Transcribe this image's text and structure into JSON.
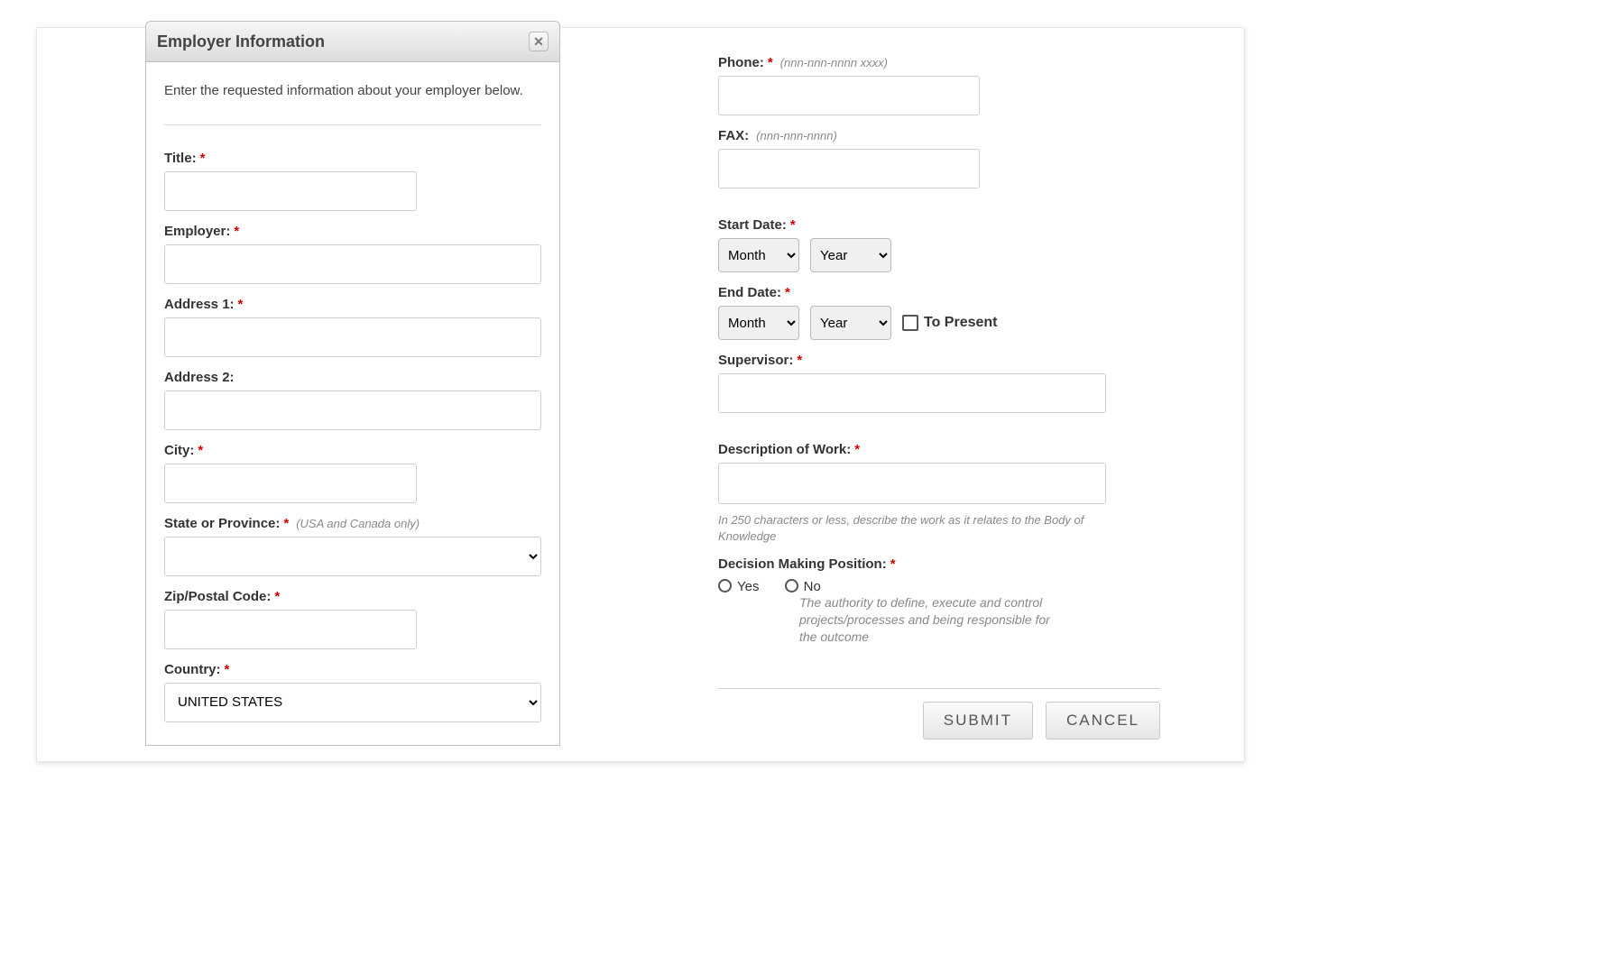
{
  "panel": {
    "title": "Employer Information",
    "intro": "Enter the requested information about your employer below."
  },
  "left": {
    "title_label": "Title:",
    "employer_label": "Employer:",
    "address1_label": "Address 1:",
    "address2_label": "Address 2:",
    "city_label": "City:",
    "state_label": "State or Province:",
    "state_hint": "(USA and Canada only)",
    "zip_label": "Zip/Postal Code:",
    "country_label": "Country:",
    "country_value": "UNITED STATES"
  },
  "right": {
    "phone_label": "Phone:",
    "phone_hint": "(nnn-nnn-nnnn xxxx)",
    "fax_label": "FAX:",
    "fax_hint": "(nnn-nnn-nnnn)",
    "start_label": "Start Date:",
    "end_label": "End Date:",
    "month_placeholder": "Month",
    "year_placeholder": "Year",
    "to_present": "To Present",
    "supervisor_label": "Supervisor:",
    "desc_label": "Description of Work:",
    "desc_hint": "In 250 characters or less, describe the work as it relates to the Body of Knowledge",
    "decision_label": "Decision Making Position:",
    "yes": "Yes",
    "no": "No",
    "decision_hint": "The authority to define, execute and control projects/processes and being responsible for the outcome"
  },
  "buttons": {
    "submit": "SUBMIT",
    "cancel": "CANCEL"
  }
}
